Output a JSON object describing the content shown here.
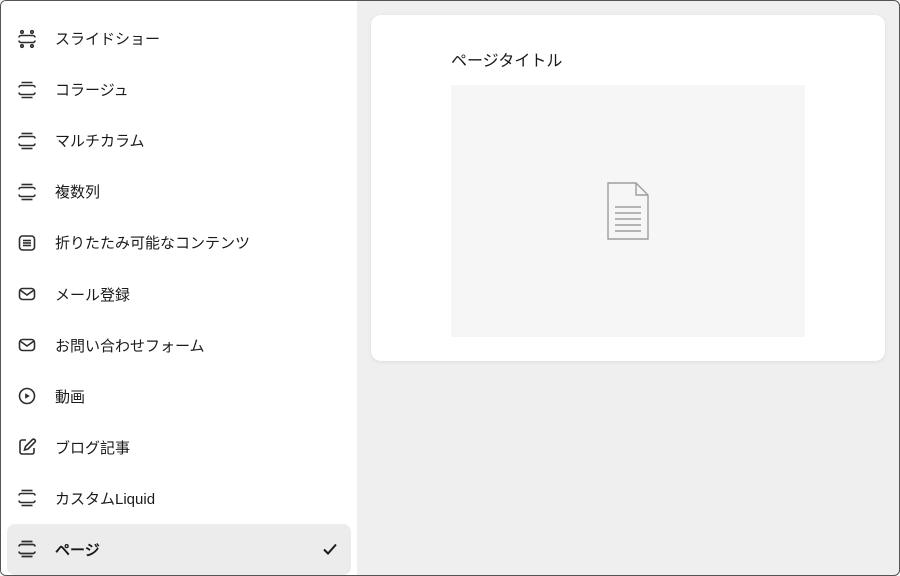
{
  "sidebar": {
    "items": [
      {
        "label": "スライドショー",
        "icon": "slideshow-icon",
        "selected": false
      },
      {
        "label": "コラージュ",
        "icon": "section-icon",
        "selected": false
      },
      {
        "label": "マルチカラム",
        "icon": "section-icon",
        "selected": false
      },
      {
        "label": "複数列",
        "icon": "section-icon",
        "selected": false
      },
      {
        "label": "折りたたみ可能なコンテンツ",
        "icon": "collapse-icon",
        "selected": false
      },
      {
        "label": "メール登録",
        "icon": "mail-icon",
        "selected": false
      },
      {
        "label": "お問い合わせフォーム",
        "icon": "mail-icon",
        "selected": false
      },
      {
        "label": "動画",
        "icon": "play-icon",
        "selected": false
      },
      {
        "label": "ブログ記事",
        "icon": "edit-icon",
        "selected": false
      },
      {
        "label": "カスタムLiquid",
        "icon": "section-icon",
        "selected": false
      },
      {
        "label": "ページ",
        "icon": "section-icon",
        "selected": true
      }
    ]
  },
  "preview": {
    "title": "ページタイトル"
  }
}
